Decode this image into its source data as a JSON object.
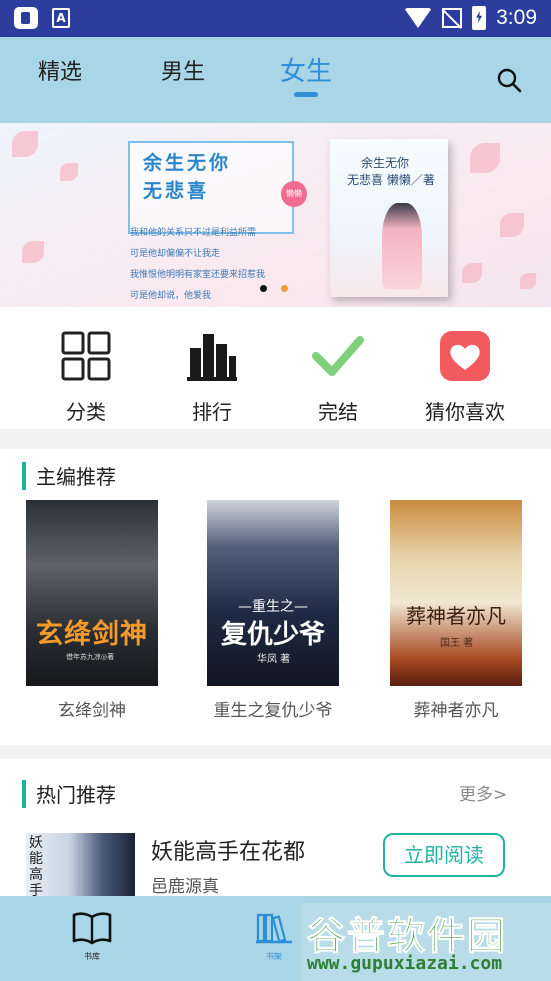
{
  "status_bar": {
    "time": "3:09"
  },
  "top_nav": {
    "tabs": [
      {
        "label": "精选",
        "active": false
      },
      {
        "label": "男生",
        "active": false
      },
      {
        "label": "女生",
        "active": true
      }
    ],
    "search_icon": "search-icon"
  },
  "banner": {
    "title_line1": "余生无你",
    "title_line2": "无悲喜",
    "badge": "懒懒",
    "lines": [
      "我和他的关系只不过是利益所需",
      "可是他却偏偏不让我走",
      "我惟恨他明明有家室还要来招惹我",
      "可是他却说，他爱我"
    ],
    "cover_title_line1": "余生无你",
    "cover_title_line2": "无悲喜 懒懒／著",
    "pages": 2,
    "active_page": 2
  },
  "shortcuts": [
    {
      "label": "分类",
      "icon": "grid-icon"
    },
    {
      "label": "排行",
      "icon": "bar-chart-icon"
    },
    {
      "label": "完结",
      "icon": "check-icon"
    },
    {
      "label": "猜你喜欢",
      "icon": "heart-icon"
    }
  ],
  "editor_picks": {
    "title": "主编推荐",
    "books": [
      {
        "name": "玄绛剑神",
        "cover_title": "玄绛剑神",
        "cover_author": "借年苏九凉◎著"
      },
      {
        "name": "重生之复仇少爷",
        "cover_pre": "—重生之—",
        "cover_title": "复仇少爷",
        "cover_author": "华凤 著"
      },
      {
        "name": "葬神者亦凡",
        "cover_title": "葬神者亦凡",
        "cover_author": "国王 著"
      }
    ]
  },
  "hot_picks": {
    "title": "热门推荐",
    "more": "更多>",
    "item": {
      "cover_text": "妖能高手",
      "title": "妖能高手在花都",
      "author": "邑鹿源真",
      "button": "立即阅读"
    }
  },
  "bottom_nav": {
    "items": [
      {
        "label": "书库",
        "icon": "book-open-icon"
      },
      {
        "label": "书架",
        "icon": "bookshelf-icon"
      }
    ]
  },
  "watermark": {
    "title": "谷普软件园",
    "url": "www.gupuxiazai.com"
  },
  "colors": {
    "status_bar": "#2c3d9e",
    "nav_bg": "#a8d6e6",
    "active_tab": "#2f8ed8",
    "accent_green": "#20b3a2"
  }
}
